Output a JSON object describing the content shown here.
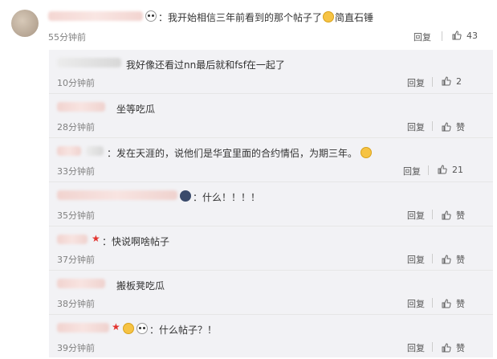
{
  "main_comment": {
    "text": "：我开始相信三年前看到的那个帖子了",
    "text_suffix": "简直石锤",
    "time": "55分钟前",
    "reply_label": "回复",
    "like_count": "43"
  },
  "replies": [
    {
      "text": "我好像还看过nn最后就和fsf在一起了",
      "time": "10分钟前",
      "reply_label": "回复",
      "like_label": "2"
    },
    {
      "text": "坐等吃瓜",
      "time": "28分钟前",
      "reply_label": "回复",
      "like_label": "赞"
    },
    {
      "text": "：发在天涯的，说他们是华宜里面的合约情侣，为期三年。",
      "time": "33分钟前",
      "reply_label": "回复",
      "like_label": "21"
    },
    {
      "text": "：什么！！！！",
      "time": "35分钟前",
      "reply_label": "回复",
      "like_label": "赞"
    },
    {
      "text": "：快说啊啥帖子",
      "time": "37分钟前",
      "reply_label": "回复",
      "like_label": "赞"
    },
    {
      "text": "搬板凳吃瓜",
      "time": "38分钟前",
      "reply_label": "回复",
      "like_label": "赞"
    },
    {
      "text": "：什么帖子？！",
      "time": "39分钟前",
      "reply_label": "回复",
      "like_label": "赞"
    }
  ]
}
